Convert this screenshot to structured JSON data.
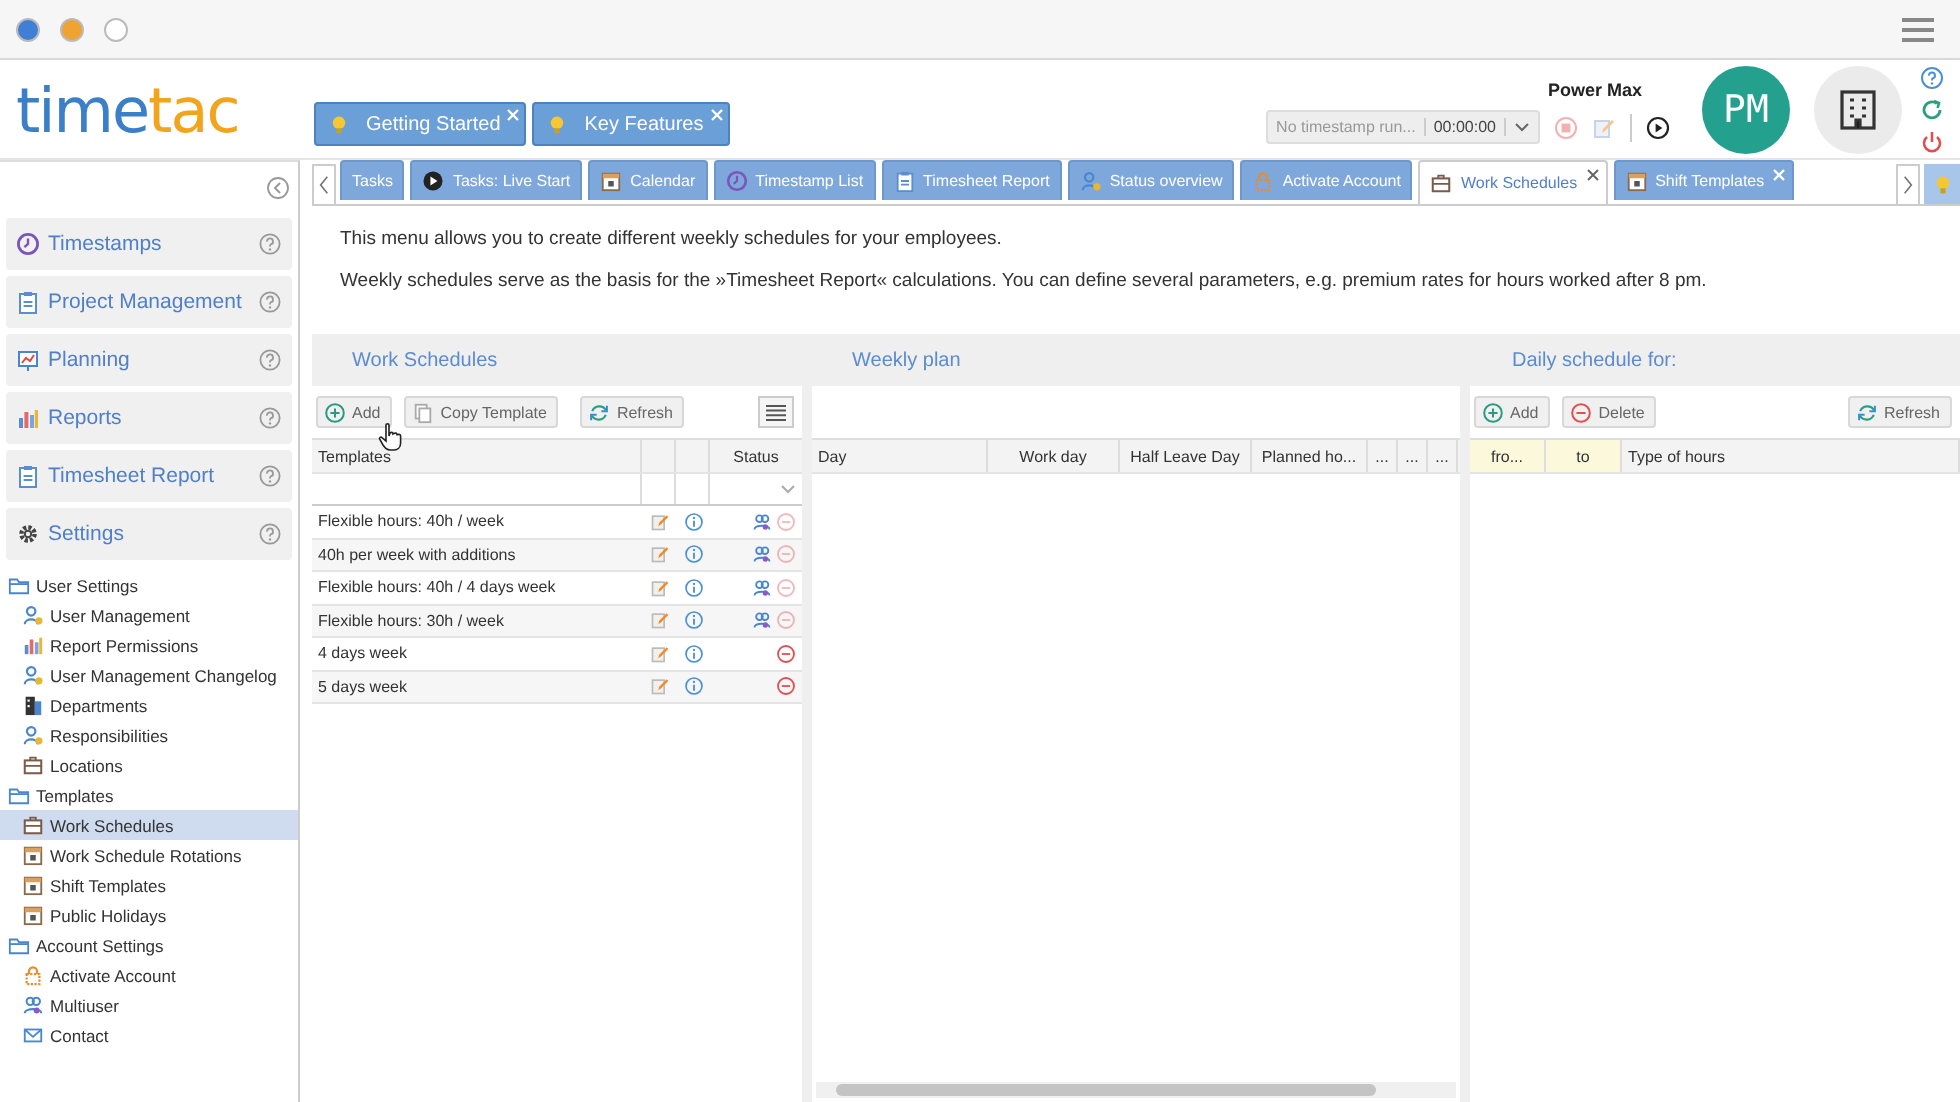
{
  "window": {
    "controls": [
      {
        "color": "#3f7fd6"
      },
      {
        "color": "#f0a232"
      },
      {
        "color": "#ffffff"
      }
    ]
  },
  "logo": {
    "text": "time",
    "accent_text": "tac"
  },
  "help_tabs": [
    {
      "label": "Getting Started"
    },
    {
      "label": "Key Features"
    }
  ],
  "timer": {
    "status_text": "No timestamp run...",
    "time": "00:00:00"
  },
  "user": {
    "name": "Power Max",
    "initials": "PM"
  },
  "nav_tabs": [
    {
      "label": "Tasks",
      "kind": "tasks",
      "selected": false,
      "closable": false
    },
    {
      "label": "Tasks: Live Start",
      "kind": "play",
      "selected": false,
      "closable": false
    },
    {
      "label": "Calendar",
      "kind": "calendar",
      "selected": false,
      "closable": false
    },
    {
      "label": "Timestamp List",
      "kind": "clock",
      "selected": false,
      "closable": false
    },
    {
      "label": "Timesheet Report",
      "kind": "clipboard",
      "selected": false,
      "closable": false
    },
    {
      "label": "Status overview",
      "kind": "person",
      "selected": false,
      "closable": false
    },
    {
      "label": "Activate Account",
      "kind": "lock",
      "selected": false,
      "closable": false
    },
    {
      "label": "Work Schedules",
      "kind": "briefcase",
      "selected": true,
      "closable": true
    },
    {
      "label": "Shift Templates",
      "kind": "calendar",
      "selected": false,
      "closable": true
    }
  ],
  "sidebar": {
    "sections": [
      {
        "label": "Timestamps",
        "kind": "clock"
      },
      {
        "label": "Project Management",
        "kind": "clipboard"
      },
      {
        "label": "Planning",
        "kind": "board"
      },
      {
        "label": "Reports",
        "kind": "chart"
      },
      {
        "label": "Timesheet Report",
        "kind": "clipboard"
      },
      {
        "label": "Settings",
        "kind": "gear"
      }
    ],
    "tree": [
      {
        "label": "User Settings",
        "children": [
          {
            "label": "User Management",
            "kind": "person",
            "selected": false
          },
          {
            "label": "Report Permissions",
            "kind": "chart",
            "selected": false
          },
          {
            "label": "User Management Changelog",
            "kind": "person",
            "selected": false
          },
          {
            "label": "Departments",
            "kind": "building",
            "selected": false
          },
          {
            "label": "Responsibilities",
            "kind": "person",
            "selected": false
          },
          {
            "label": "Locations",
            "kind": "briefcase",
            "selected": false
          }
        ]
      },
      {
        "label": "Templates",
        "children": [
          {
            "label": "Work Schedules",
            "kind": "briefcase",
            "selected": true
          },
          {
            "label": "Work Schedule Rotations",
            "kind": "calendar",
            "selected": false
          },
          {
            "label": "Shift Templates",
            "kind": "calendar",
            "selected": false
          },
          {
            "label": "Public Holidays",
            "kind": "calendar",
            "selected": false
          }
        ]
      },
      {
        "label": "Account Settings",
        "children": [
          {
            "label": "Activate Account",
            "kind": "lock",
            "selected": false
          },
          {
            "label": "Multiuser",
            "kind": "users",
            "selected": false
          },
          {
            "label": "Contact",
            "kind": "mail",
            "selected": false
          }
        ]
      }
    ]
  },
  "intro": [
    "This menu allows you to create different weekly schedules for your employees.",
    "Weekly schedules serve as the basis for the »Timesheet Report« calculations. You can define several parameters, e.g. premium rates for hours worked after 8 pm."
  ],
  "work_schedules": {
    "title": "Work Schedules",
    "toolbar": [
      {
        "label": "Add",
        "kind": "add"
      },
      {
        "label": "Copy Template",
        "kind": "copy"
      },
      {
        "label": "Refresh",
        "kind": "refresh"
      }
    ],
    "columns": [
      {
        "kind": "text",
        "label": "Templates"
      },
      {
        "kind": "icon"
      },
      {
        "kind": "icon"
      },
      {
        "kind": "status",
        "label": "Status"
      }
    ],
    "rows": [
      {
        "name": "Flexible hours: 40h / week",
        "assigned": true
      },
      {
        "name": "40h per week with additions",
        "assigned": true
      },
      {
        "name": "Flexible hours: 40h / 4 days week",
        "assigned": true
      },
      {
        "name": "Flexible hours: 30h / week",
        "assigned": true
      },
      {
        "name": "4 days week",
        "assigned": false
      },
      {
        "name": "5 days week",
        "assigned": false
      }
    ]
  },
  "weekly_plan": {
    "title": "Weekly plan",
    "columns": [
      "Day",
      "Work day",
      "Half Leave Day",
      "Planned ho...",
      "...",
      "...",
      "..."
    ]
  },
  "daily_schedule": {
    "title": "Daily schedule for:",
    "toolbar": [
      {
        "label": "Add",
        "kind": "add"
      },
      {
        "label": "Delete",
        "kind": "delete"
      },
      {
        "label": "Refresh",
        "kind": "refresh"
      }
    ],
    "columns": [
      {
        "label": "fro...",
        "highlighted": true
      },
      {
        "label": "to",
        "highlighted": true
      },
      {
        "label": "Type of hours",
        "highlighted": false
      }
    ]
  }
}
